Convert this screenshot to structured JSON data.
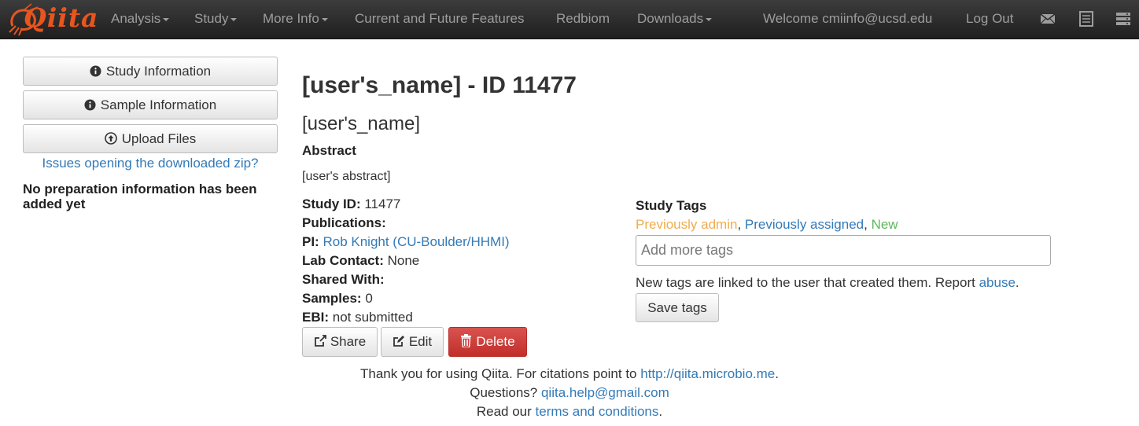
{
  "navbar": {
    "brand": "Qiita",
    "items": [
      {
        "label": "Analysis",
        "dropdown": true
      },
      {
        "label": "Study",
        "dropdown": true
      },
      {
        "label": "More Info",
        "dropdown": true
      },
      {
        "label": "Current and Future Features",
        "dropdown": false
      },
      {
        "label": "Redbiom",
        "dropdown": false
      },
      {
        "label": "Downloads",
        "dropdown": true
      }
    ],
    "welcome": "Welcome cmiinfo@ucsd.edu",
    "logout": "Log Out",
    "icons": [
      "envelope-icon",
      "list-icon",
      "server-icon"
    ],
    "text_color": "#9d9d9d",
    "brand_color": "#e8551d"
  },
  "sidebar": {
    "buttons": [
      {
        "label": "Study Information",
        "icon": "info-circle-icon"
      },
      {
        "label": "Sample Information",
        "icon": "info-circle-icon"
      },
      {
        "label": "Upload Files",
        "icon": "upload-circle-icon"
      }
    ],
    "link": "Issues opening the downloaded zip?",
    "note": "No preparation information has been added yet"
  },
  "study": {
    "title": "[user's_name] - ID 11477",
    "subtitle": "[user's_name]",
    "abstract_label": "Abstract",
    "abstract": "[user's abstract]",
    "fields": {
      "study_id_label": "Study ID:",
      "study_id": "11477",
      "publications_label": "Publications:",
      "pi_label": "PI:",
      "pi": "Rob Knight (CU-Boulder/HHMI)",
      "lab_contact_label": "Lab Contact:",
      "lab_contact": "None",
      "shared_with_label": "Shared With:",
      "samples_label": "Samples:",
      "samples": "0",
      "ebi_label": "EBI:",
      "ebi": "not submitted"
    },
    "actions": {
      "share": "Share",
      "edit": "Edit",
      "delete": "Delete"
    }
  },
  "tags": {
    "label": "Study Tags",
    "legend_admin": "Previously admin",
    "legend_assigned": "Previously assigned",
    "legend_new": "New",
    "placeholder": "Add more tags",
    "note_prefix": "New tags are linked to the user that created them. Report ",
    "note_link": "abuse",
    "note_suffix": ".",
    "save": "Save tags",
    "colors": {
      "admin": "#f0ad4e",
      "assigned": "#337ab7",
      "new": "#5cb85c"
    }
  },
  "footer": {
    "line1_prefix": "Thank you for using Qiita. For citations point to ",
    "line1_link": "http://qiita.microbio.me",
    "line1_suffix": ".",
    "line2_prefix": "Questions? ",
    "line2_link": "qiita.help@gmail.com",
    "line3_prefix": "Read our ",
    "line3_link": "terms and conditions",
    "line3_suffix": "."
  },
  "colors": {
    "link": "#337ab7",
    "danger": "#d9534f"
  }
}
